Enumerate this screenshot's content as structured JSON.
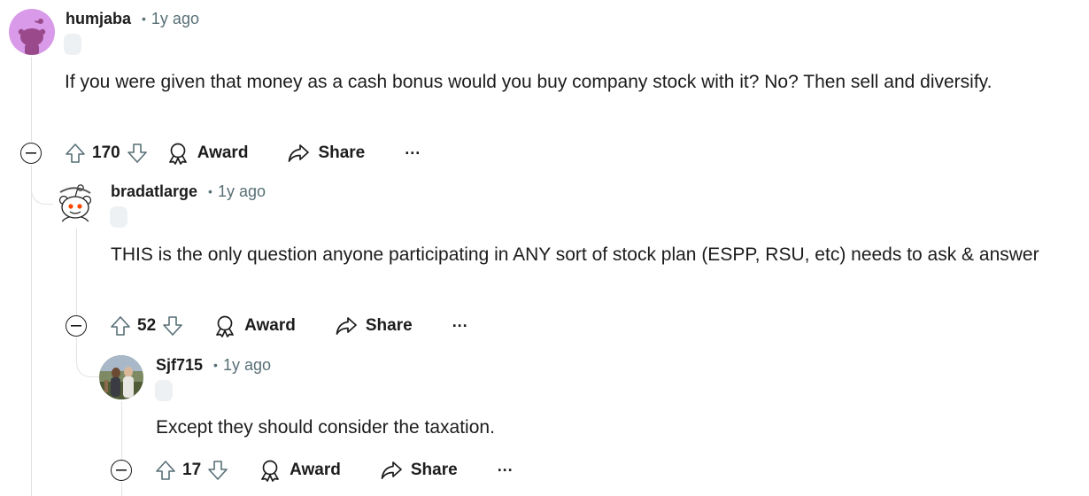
{
  "comments": [
    {
      "username": "humjaba",
      "timestamp": "1y ago",
      "body": "If you were given that money as a cash bonus would you buy company stock with it? No? Then sell and diversify.",
      "score": "170",
      "award_label": "Award",
      "share_label": "Share",
      "more_label": "···",
      "avatar_color": "#d89ae9"
    },
    {
      "username": "bradatlarge",
      "timestamp": "1y ago",
      "body": "THIS is the only question anyone participating in ANY sort of stock plan (ESPP, RSU, etc) needs to ask & answer",
      "score": "52",
      "award_label": "Award",
      "share_label": "Share",
      "more_label": "···",
      "avatar_color": "#ffffff"
    },
    {
      "username": "Sjf715",
      "timestamp": "1y ago",
      "body": "Except they should consider the taxation.",
      "score": "17",
      "award_label": "Award",
      "share_label": "Share",
      "more_label": "···",
      "avatar_color": "#6f7a4e"
    }
  ],
  "separator": "•",
  "icons": {
    "upvote": "upvote-arrow-icon",
    "downvote": "downvote-arrow-icon",
    "award": "award-ribbon-icon",
    "share": "share-arrow-icon",
    "collapse": "collapse-minus-icon"
  },
  "colors": {
    "text": "#1c1c1c",
    "meta": "#576f76",
    "thread_line": "#dfe3e6",
    "flair_bg": "#eef1f3"
  }
}
